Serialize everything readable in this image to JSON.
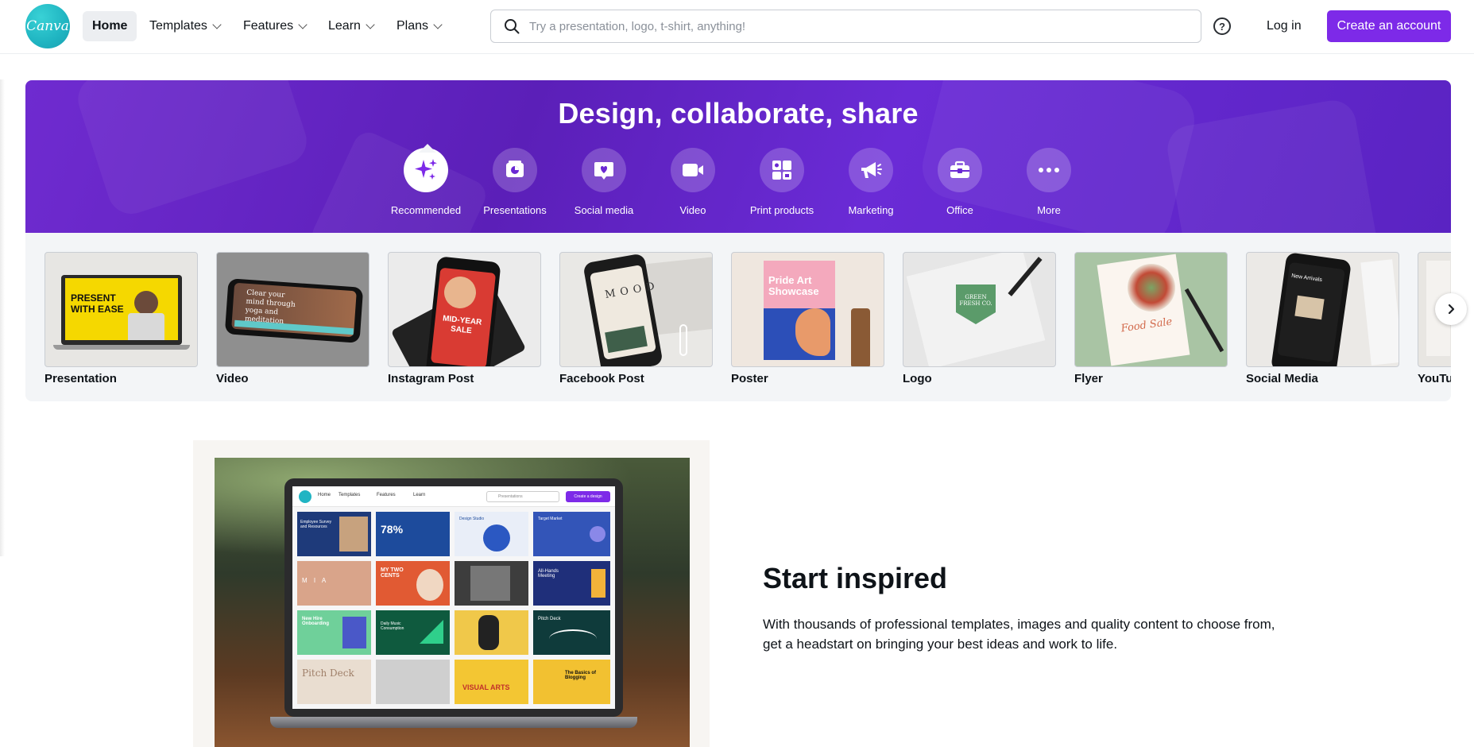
{
  "nav": {
    "logo_text": "Canva",
    "items": [
      {
        "label": "Home"
      },
      {
        "label": "Templates"
      },
      {
        "label": "Features"
      },
      {
        "label": "Learn"
      },
      {
        "label": "Plans"
      }
    ],
    "search_placeholder": "Try a presentation, logo, t-shirt, anything!",
    "help_icon": "?",
    "login": "Log in",
    "create_account": "Create an account"
  },
  "hero": {
    "title": "Design, collaborate, share",
    "categories": [
      {
        "label": "Recommended",
        "icon": "sparkle-icon"
      },
      {
        "label": "Presentations",
        "icon": "presentation-icon"
      },
      {
        "label": "Social media",
        "icon": "heart-icon"
      },
      {
        "label": "Video",
        "icon": "video-camera-icon"
      },
      {
        "label": "Print products",
        "icon": "print-products-icon"
      },
      {
        "label": "Marketing",
        "icon": "megaphone-icon"
      },
      {
        "label": "Office",
        "icon": "briefcase-icon"
      },
      {
        "label": "More",
        "icon": "more-icon"
      }
    ]
  },
  "templates": [
    {
      "label": "Presentation",
      "thumb_text": "PRESENT WITH EASE"
    },
    {
      "label": "Video",
      "thumb_text": "Clear your mind through yoga and meditation"
    },
    {
      "label": "Instagram Post",
      "thumb_text": "MID-YEAR SALE"
    },
    {
      "label": "Facebook Post",
      "thumb_text": "MOOD"
    },
    {
      "label": "Poster",
      "thumb_text": "Pride Art Showcase"
    },
    {
      "label": "Logo",
      "thumb_text": "GREEN FRESH CO."
    },
    {
      "label": "Flyer",
      "thumb_text": "Food Sale"
    },
    {
      "label": "Social Media",
      "thumb_text": "New Arrivals"
    },
    {
      "label": "YouTu",
      "thumb_text": ""
    }
  ],
  "inspired": {
    "title": "Start inspired",
    "text": "With thousands of professional templates, images and quality content to choose from, get a headstart on bringing your best ideas and work to life.",
    "laptop_nav": [
      "Home",
      "Templates",
      "Features",
      "Learn"
    ],
    "laptop_search": "Presentations",
    "laptop_button": "Create a design",
    "laptop_tiles": [
      "Employee Survey and Resources",
      "78%",
      "Design Studio",
      "Target Market",
      "M I A",
      "MY TWO CENTS",
      "All-Hands Meeting",
      "New Hire Onboarding",
      "Daily Music Consumption",
      "Pitch Deck",
      "Pitch Deck",
      "VISUAL ARTS",
      "The Basics of Blogging"
    ]
  },
  "colors": {
    "brand_purple": "#7d2ae8",
    "hero_purple": "#6420c9",
    "logo_teal": "#20b4c3"
  }
}
